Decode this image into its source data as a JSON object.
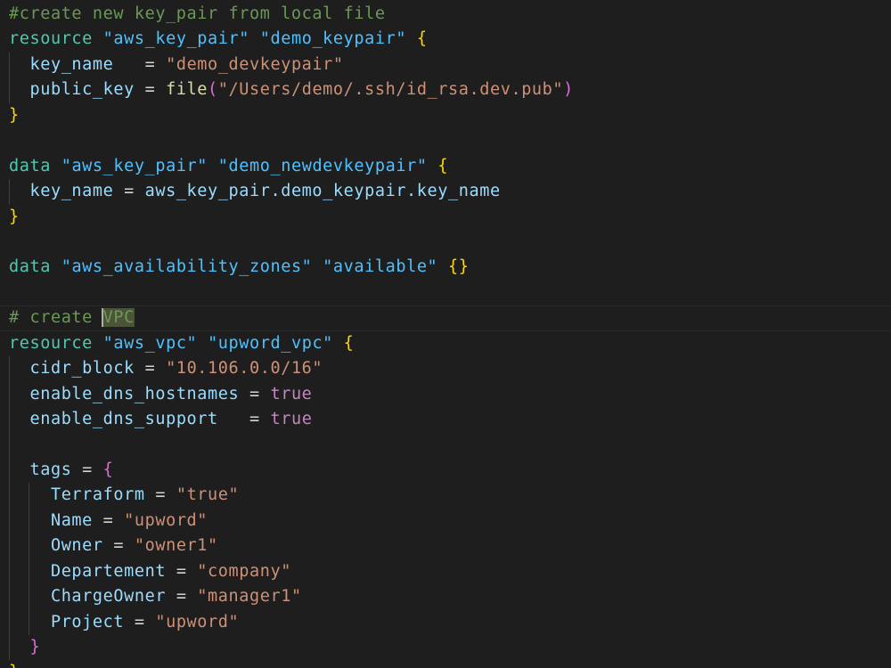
{
  "colors": {
    "background": "#1e1e1e",
    "comment": "#6a9955",
    "keyword": "#4ec9b0",
    "string": "#ce9178",
    "attribute": "#9cdcfe",
    "brace": "#ffd700",
    "nested_brace": "#da70d6",
    "boolean": "#c586c0",
    "function": "#dcdcaa"
  },
  "lines": [
    [
      {
        "t": "comment",
        "v": "#create new key_pair from local file"
      }
    ],
    [
      {
        "t": "keyword",
        "v": "resource"
      },
      {
        "t": "op",
        "v": " "
      },
      {
        "t": "type",
        "v": "\"aws_key_pair\""
      },
      {
        "t": "op",
        "v": " "
      },
      {
        "t": "name",
        "v": "\"demo_keypair\""
      },
      {
        "t": "op",
        "v": " "
      },
      {
        "t": "brace",
        "v": "{"
      }
    ],
    [
      {
        "t": "op",
        "v": "  "
      },
      {
        "t": "attr",
        "v": "key_name"
      },
      {
        "t": "op",
        "v": "   = "
      },
      {
        "t": "string",
        "v": "\"demo_devkeypair\""
      }
    ],
    [
      {
        "t": "op",
        "v": "  "
      },
      {
        "t": "attr",
        "v": "public_key"
      },
      {
        "t": "op",
        "v": " = "
      },
      {
        "t": "func",
        "v": "file"
      },
      {
        "t": "paren",
        "v": "("
      },
      {
        "t": "string",
        "v": "\"/Users/demo/.ssh/id_rsa.dev.pub\""
      },
      {
        "t": "paren",
        "v": ")"
      }
    ],
    [
      {
        "t": "brace",
        "v": "}"
      }
    ],
    [],
    [
      {
        "t": "keyword",
        "v": "data"
      },
      {
        "t": "op",
        "v": " "
      },
      {
        "t": "type",
        "v": "\"aws_key_pair\""
      },
      {
        "t": "op",
        "v": " "
      },
      {
        "t": "name",
        "v": "\"demo_newdevkeypair\""
      },
      {
        "t": "op",
        "v": " "
      },
      {
        "t": "brace",
        "v": "{"
      }
    ],
    [
      {
        "t": "op",
        "v": "  "
      },
      {
        "t": "attr",
        "v": "key_name"
      },
      {
        "t": "op",
        "v": " = "
      },
      {
        "t": "ref",
        "v": "aws_key_pair.demo_keypair.key_name"
      }
    ],
    [
      {
        "t": "brace",
        "v": "}"
      }
    ],
    [],
    [
      {
        "t": "keyword",
        "v": "data"
      },
      {
        "t": "op",
        "v": " "
      },
      {
        "t": "type",
        "v": "\"aws_availability_zones\""
      },
      {
        "t": "op",
        "v": " "
      },
      {
        "t": "name",
        "v": "\"available\""
      },
      {
        "t": "op",
        "v": " "
      },
      {
        "t": "brace",
        "v": "{}"
      }
    ],
    [],
    [
      {
        "t": "comment",
        "v": "# create "
      },
      {
        "t": "sel",
        "v": "VPC"
      }
    ],
    [
      {
        "t": "keyword",
        "v": "resource"
      },
      {
        "t": "op",
        "v": " "
      },
      {
        "t": "type",
        "v": "\"aws_vpc\""
      },
      {
        "t": "op",
        "v": " "
      },
      {
        "t": "name",
        "v": "\"upword_vpc\""
      },
      {
        "t": "op",
        "v": " "
      },
      {
        "t": "brace",
        "v": "{"
      }
    ],
    [
      {
        "t": "op",
        "v": "  "
      },
      {
        "t": "attr",
        "v": "cidr_block"
      },
      {
        "t": "op",
        "v": " = "
      },
      {
        "t": "string",
        "v": "\"10.106.0.0/16\""
      }
    ],
    [
      {
        "t": "op",
        "v": "  "
      },
      {
        "t": "attr",
        "v": "enable_dns_hostnames"
      },
      {
        "t": "op",
        "v": " = "
      },
      {
        "t": "bool",
        "v": "true"
      }
    ],
    [
      {
        "t": "op",
        "v": "  "
      },
      {
        "t": "attr",
        "v": "enable_dns_support"
      },
      {
        "t": "op",
        "v": "   = "
      },
      {
        "t": "bool",
        "v": "true"
      }
    ],
    [],
    [
      {
        "t": "op",
        "v": "  "
      },
      {
        "t": "attr",
        "v": "tags"
      },
      {
        "t": "op",
        "v": " = "
      },
      {
        "t": "brace2",
        "v": "{"
      }
    ],
    [
      {
        "t": "op",
        "v": "    "
      },
      {
        "t": "attr",
        "v": "Terraform"
      },
      {
        "t": "op",
        "v": " = "
      },
      {
        "t": "string",
        "v": "\"true\""
      }
    ],
    [
      {
        "t": "op",
        "v": "    "
      },
      {
        "t": "attr",
        "v": "Name"
      },
      {
        "t": "op",
        "v": " = "
      },
      {
        "t": "string",
        "v": "\"upword\""
      }
    ],
    [
      {
        "t": "op",
        "v": "    "
      },
      {
        "t": "attr",
        "v": "Owner"
      },
      {
        "t": "op",
        "v": " = "
      },
      {
        "t": "string",
        "v": "\"owner1\""
      }
    ],
    [
      {
        "t": "op",
        "v": "    "
      },
      {
        "t": "attr",
        "v": "Departement"
      },
      {
        "t": "op",
        "v": " = "
      },
      {
        "t": "string",
        "v": "\"company\""
      }
    ],
    [
      {
        "t": "op",
        "v": "    "
      },
      {
        "t": "attr",
        "v": "ChargeOwner"
      },
      {
        "t": "op",
        "v": " = "
      },
      {
        "t": "string",
        "v": "\"manager1\""
      }
    ],
    [
      {
        "t": "op",
        "v": "    "
      },
      {
        "t": "attr",
        "v": "Project"
      },
      {
        "t": "op",
        "v": " = "
      },
      {
        "t": "string",
        "v": "\"upword\""
      }
    ],
    [
      {
        "t": "op",
        "v": "  "
      },
      {
        "t": "brace2",
        "v": "}"
      }
    ],
    [
      {
        "t": "brace",
        "v": "}"
      }
    ]
  ]
}
